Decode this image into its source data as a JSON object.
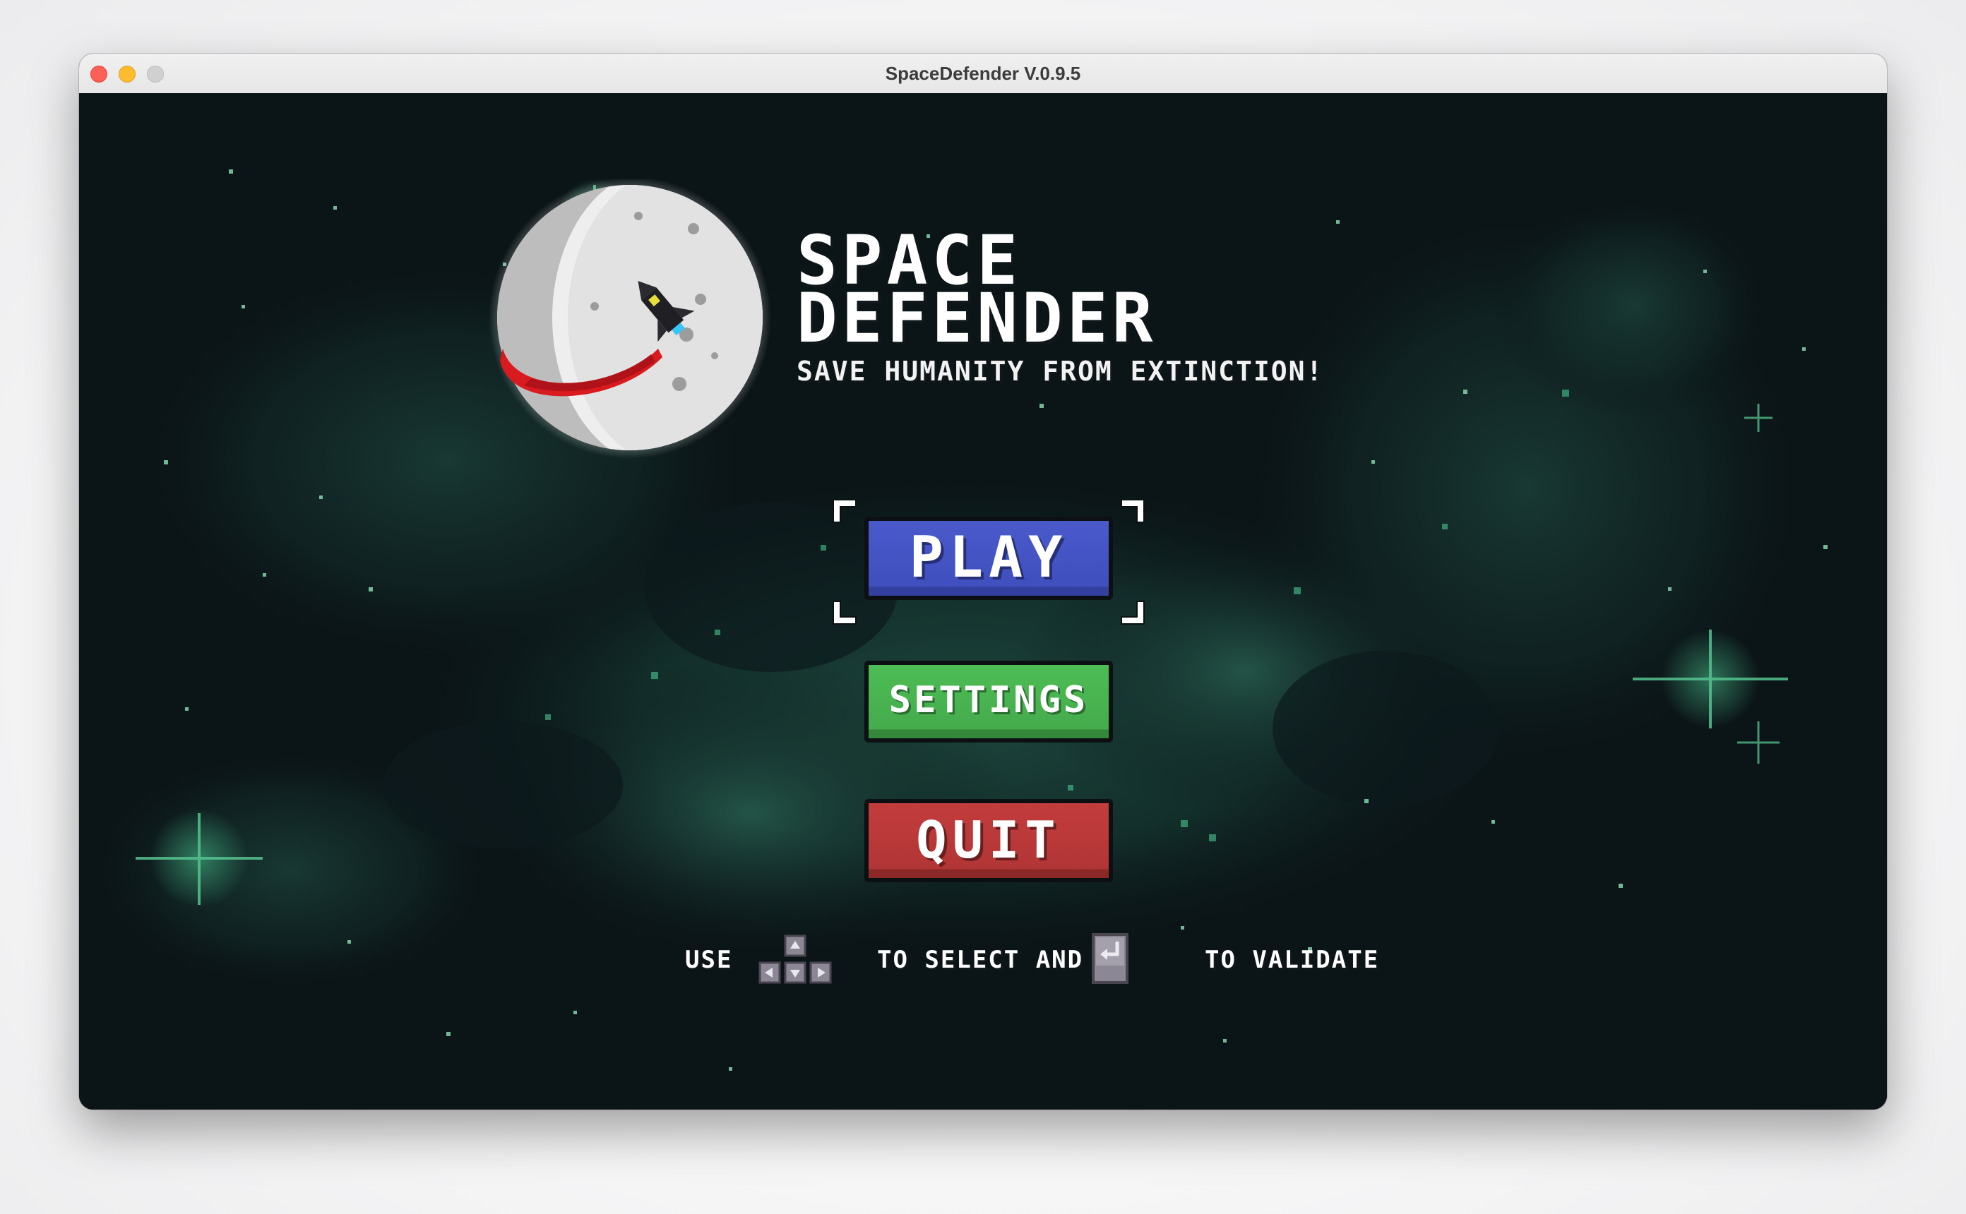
{
  "window": {
    "title": "SpaceDefender V.0.9.5"
  },
  "game": {
    "title_line1": "SPACE",
    "title_line2": "DEFENDER",
    "subtitle": "SAVE HUMANITY FROM EXTINCTION!",
    "logo_icon": "moon-with-rocket-icon"
  },
  "menu": {
    "selected": "PLAY",
    "play_label": "PLAY",
    "settings_label": "SETTINGS",
    "quit_label": "QUIT",
    "colors": {
      "play": "#3f4fbd",
      "settings": "#45ab4c",
      "quit": "#b23535"
    }
  },
  "hint": {
    "use": "USE",
    "arrows_icon": "arrow-keys-icon",
    "select": "TO SELECT AND",
    "enter_icon": "enter-key-icon",
    "validate": "TO VALIDATE"
  }
}
